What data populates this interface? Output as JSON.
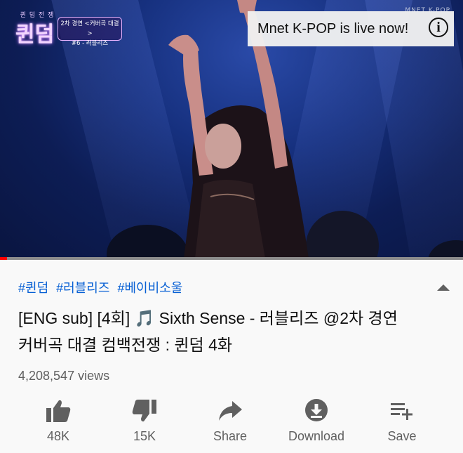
{
  "video": {
    "show_logo_sub": "퀸 덤 전 쟁",
    "show_logo": "퀸덤",
    "caption_line1": "2차 경연 <커버곡 대결>",
    "caption_line2": "#6 - 러블리즈",
    "ad_text": "Mnet K-POP is live now!",
    "info_glyph": "i",
    "watermark": "MNET K-POP",
    "progress_fraction": 0.015
  },
  "info": {
    "tags": [
      "#퀸덤",
      "#러블리즈",
      "#베이비소울"
    ],
    "title_line1": "[ENG sub] [4회] 🎵 Sixth Sense - 러블리즈 @2차 경연",
    "title_line2": "커버곡 대결 컴백전쟁 : 퀸덤 4화",
    "views": "4,208,547 views"
  },
  "actions": [
    {
      "icon": "thumbs-up-icon",
      "label": "48K"
    },
    {
      "icon": "thumbs-down-icon",
      "label": "15K"
    },
    {
      "icon": "share-icon",
      "label": "Share"
    },
    {
      "icon": "download-icon",
      "label": "Download"
    },
    {
      "icon": "save-playlist-icon",
      "label": "Save"
    }
  ],
  "colors": {
    "accent": "#065fd4",
    "progress": "#ff0000",
    "icon": "#606060"
  }
}
